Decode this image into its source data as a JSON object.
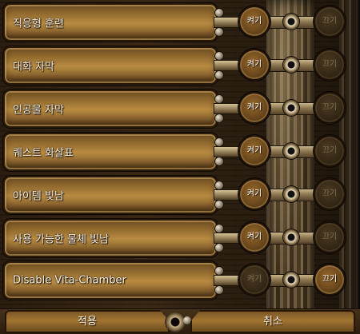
{
  "options": [
    {
      "label": "직응형 훈련",
      "on_label": "켜기",
      "off_label": "끄기",
      "value": "on"
    },
    {
      "label": "대화 자막",
      "on_label": "켜기",
      "off_label": "끄기",
      "value": "on"
    },
    {
      "label": "인공물 자막",
      "on_label": "켜기",
      "off_label": "끄기",
      "value": "on"
    },
    {
      "label": "퀘스트 화살표",
      "on_label": "켜기",
      "off_label": "끄기",
      "value": "on"
    },
    {
      "label": "아이템 빛남",
      "on_label": "켜기",
      "off_label": "끄기",
      "value": "on"
    },
    {
      "label": "사용 가능한 물체 빛남",
      "on_label": "켜기",
      "off_label": "끄기",
      "value": "on"
    },
    {
      "label": "Disable Vita-Chamber",
      "on_label": "켜기",
      "off_label": "끄기",
      "value": "off"
    }
  ],
  "footer": {
    "apply_label": "적용",
    "cancel_label": "취소"
  },
  "colors": {
    "label_text": "#f4efe4",
    "active_button_text": "#ffffff",
    "inactive_button_text": "#7c6c54",
    "brass": "#b88b41"
  }
}
